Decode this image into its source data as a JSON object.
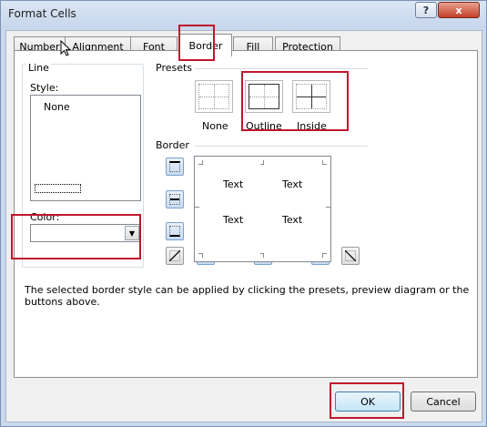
{
  "window": {
    "title": "Format Cells",
    "help_glyph": "?",
    "close_glyph": "x"
  },
  "tabs": [
    {
      "label": "Number"
    },
    {
      "label": "Alignment"
    },
    {
      "label": "Font"
    },
    {
      "label": "Border",
      "active": true
    },
    {
      "label": "Fill"
    },
    {
      "label": "Protection"
    }
  ],
  "line": {
    "group_label": "Line",
    "style_label": "Style:",
    "style_option_none": "None",
    "color_label": "Color:"
  },
  "presets": {
    "group_label": "Presets",
    "items": [
      {
        "label": "None"
      },
      {
        "label": "Outline"
      },
      {
        "label": "Inside"
      }
    ]
  },
  "border": {
    "group_label": "Border",
    "preview_text": [
      "Text",
      "Text",
      "Text",
      "Text"
    ]
  },
  "description": "The selected border style can be applied by clicking the presets, preview diagram or the buttons above.",
  "buttons": {
    "ok": "OK",
    "cancel": "Cancel"
  },
  "colors": {
    "highlight": "#c0172d",
    "title_bar": "#c9d9ee",
    "accent": "#7aa2d0"
  }
}
